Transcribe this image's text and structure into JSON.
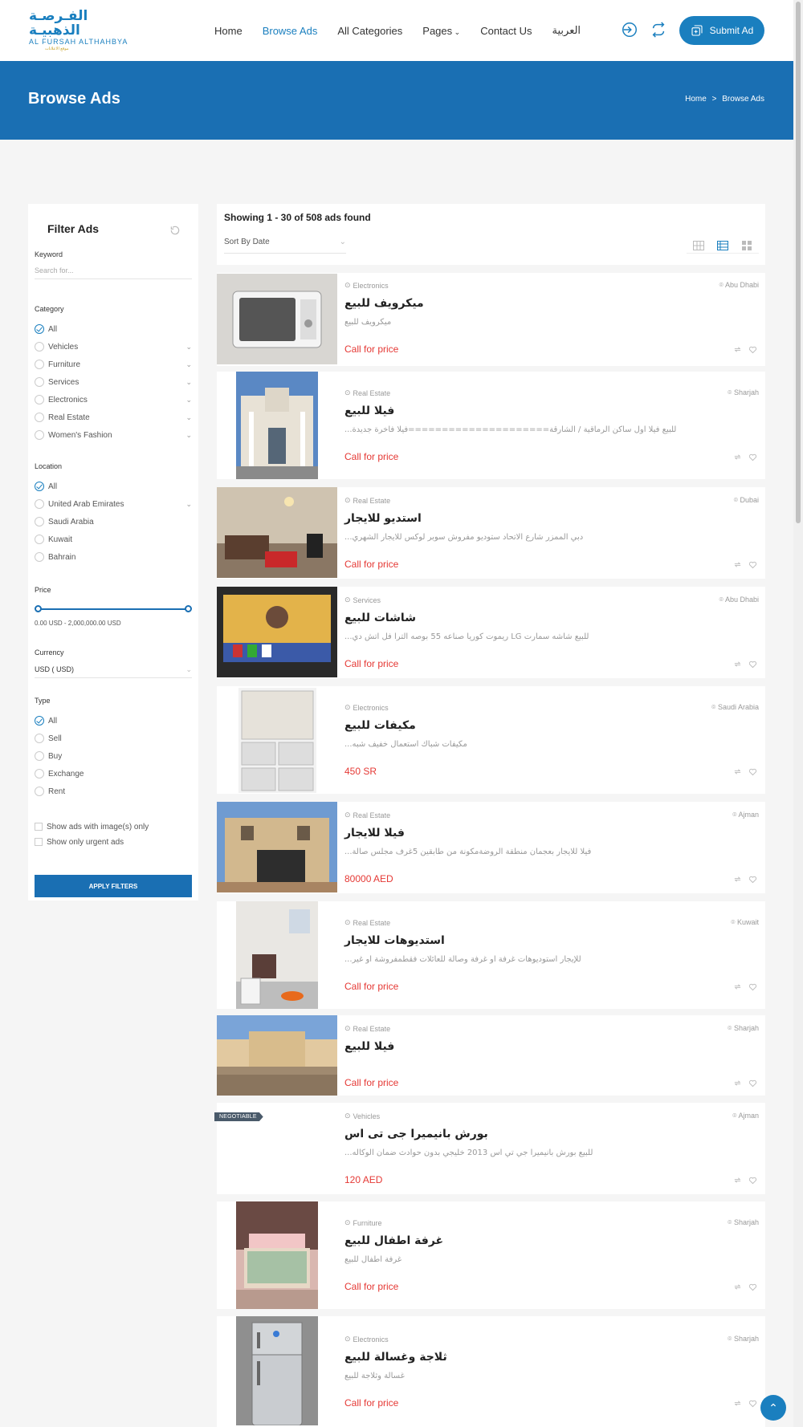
{
  "header": {
    "logo_ar": "الفـرصـة الذهبيـة",
    "logo_en": "AL FURSAH ALTHAHBYA",
    "logo_sub": "موقع الاعلانات",
    "nav": [
      {
        "label": "Home"
      },
      {
        "label": "Browse Ads"
      },
      {
        "label": "All Categories"
      },
      {
        "label": "Pages"
      },
      {
        "label": "Contact Us"
      },
      {
        "label": "العربية"
      }
    ],
    "submit_label": "Submit Ad"
  },
  "banner": {
    "title": "Browse Ads",
    "crumb_home": "Home",
    "crumb_sep": ">",
    "crumb_current": "Browse Ads"
  },
  "filters": {
    "title": "Filter Ads",
    "keyword_label": "Keyword",
    "keyword_placeholder": "Search for...",
    "category_label": "Category",
    "categories": [
      "All",
      "Vehicles",
      "Furniture",
      "Services",
      "Electronics",
      "Real Estate",
      "Women's Fashion"
    ],
    "location_label": "Location",
    "locations": [
      "All",
      "United Arab Emirates",
      "Saudi Arabia",
      "Kuwait",
      "Bahrain"
    ],
    "price_label": "Price",
    "price_range": "0.00 USD - 2,000,000.00 USD",
    "currency_label": "Currency",
    "currency_value": "USD ( USD)",
    "type_label": "Type",
    "types": [
      "All",
      "Sell",
      "Buy",
      "Exchange",
      "Rent"
    ],
    "images_only": "Show ads with image(s) only",
    "urgent_only": "Show only urgent ads",
    "apply": "APPLY FILTERS"
  },
  "results": {
    "count": "Showing 1 - 30 of 508 ads found",
    "sort": "Sort By Date"
  },
  "ads": [
    {
      "category": "Electronics",
      "location": "Abu Dhabi",
      "title": "ميكرويف للبيع",
      "desc": "ميكرويف للبيع",
      "price": "Call for price"
    },
    {
      "category": "Real Estate",
      "location": "Sharjah",
      "title": "فيلا للبيع",
      "desc": "للبيع فيلا اول ساكن الرماقية / الشارقة=====================فيلا فاخرة جديدة...",
      "price": "Call for price"
    },
    {
      "category": "Real Estate",
      "location": "Dubai",
      "title": "استديو للايجار",
      "desc": "دبي الممزر شارع الاتحاد ستوديو مفروش سوبر لوكس للايجار الشهري...",
      "price": "Call for price"
    },
    {
      "category": "Services",
      "location": "Abu Dhabi",
      "title": "شاشات للبيع",
      "desc": "للبيع شاشه سمارت LG ريموت كوريا صناعه 55 بوصه الترا فل اتش دي...",
      "price": "Call for price"
    },
    {
      "category": "Electronics",
      "location": "Saudi Arabia",
      "title": "مكيفات للبيع",
      "desc": "مكيفات شباك استعمال خفيف شبه...",
      "price": "450 SR"
    },
    {
      "category": "Real Estate",
      "location": "Ajman",
      "title": "فيلا للايجار",
      "desc": "فيلا للايجار بعجمان منطقة الروضةمكونة من طابقين 5غرف مجلس صالة...",
      "price": "80000 AED"
    },
    {
      "category": "Real Estate",
      "location": "Kuwait",
      "title": "استديوهات للايجار",
      "desc": "للإيجار استوديوهات غرفة او غرفة وصالة للعائلات فقطمفروشة او غير...",
      "price": "Call for price"
    },
    {
      "category": "Real Estate",
      "location": "Sharjah",
      "title": "فيلا للبيع",
      "desc": "",
      "price": "Call for price"
    },
    {
      "category": "Vehicles",
      "location": "Ajman",
      "title": "بورش بانيميرا جى تى اس",
      "desc": "للبيع بورش بانيميرا جي تي اس 2013  خليجي بدون حوادث ضمان الوكاله...",
      "price": "120 AED",
      "badge": "NEGOTIABLE"
    },
    {
      "category": "Furniture",
      "location": "Sharjah",
      "title": "غرفة اطفال للبيع",
      "desc": "غرفة اطفال للبيع",
      "price": "Call for price"
    },
    {
      "category": "Electronics",
      "location": "Sharjah",
      "title": "ثلاجة وغسالة للبيع",
      "desc": "غسالة وثلاجة للبيع",
      "price": "Call for price"
    }
  ],
  "colors": {
    "primary": "#1a7fbf",
    "banner": "#1a6fb3",
    "price": "#e53935"
  }
}
